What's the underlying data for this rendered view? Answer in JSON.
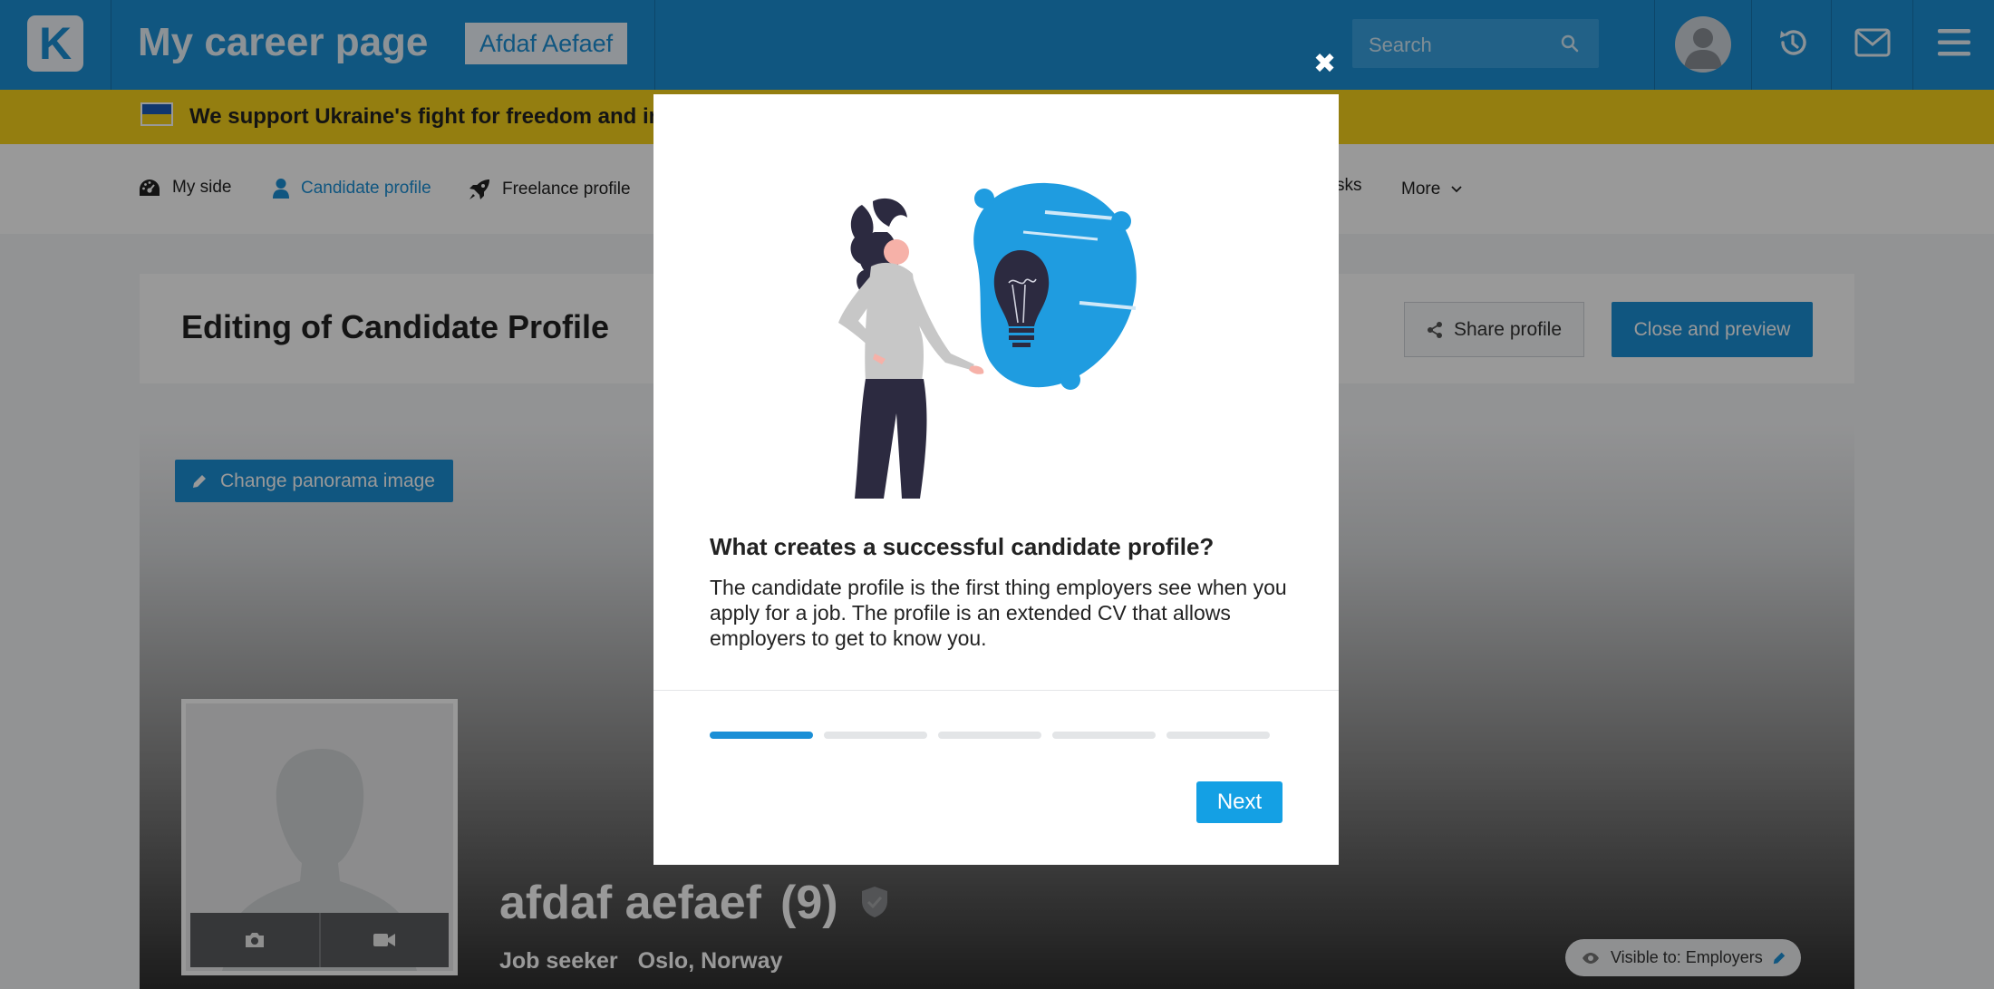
{
  "header": {
    "logo_letter": "K",
    "title": "My career page",
    "user_name": "Afdaf Aefaef",
    "search_placeholder": "Search"
  },
  "banner": {
    "text": "We support Ukraine's fight for freedom and inde"
  },
  "nav": {
    "items": [
      {
        "label": "My side",
        "icon": "dashboard-icon"
      },
      {
        "label": "Candidate profile",
        "icon": "person-icon",
        "active": true
      },
      {
        "label": "Freelance profile",
        "icon": "rocket-icon"
      },
      {
        "label": "sks"
      },
      {
        "label": "More",
        "icon": "chevron-down-icon"
      }
    ]
  },
  "editor": {
    "title": "Editing of Candidate Profile",
    "share_label": "Share profile",
    "preview_label": "Close and preview"
  },
  "profile": {
    "panorama_label": "Change panorama image",
    "name": "afdaf aefaef",
    "count": "(9)",
    "role": "Job seeker",
    "location": "Oslo, Norway",
    "visibility": "Visible to: Employers"
  },
  "modal": {
    "title": "What creates a successful candidate profile?",
    "body": "The candidate profile is the first thing employers see when you apply for a job. The profile is an extended CV that allows employers to get to know you.",
    "step": 1,
    "total_steps": 5,
    "next_label": "Next",
    "close_glyph": "✖"
  },
  "colors": {
    "brand_blue": "#1b8fd6",
    "banner_yellow": "#f7d21c",
    "next_blue": "#14a0e4"
  }
}
